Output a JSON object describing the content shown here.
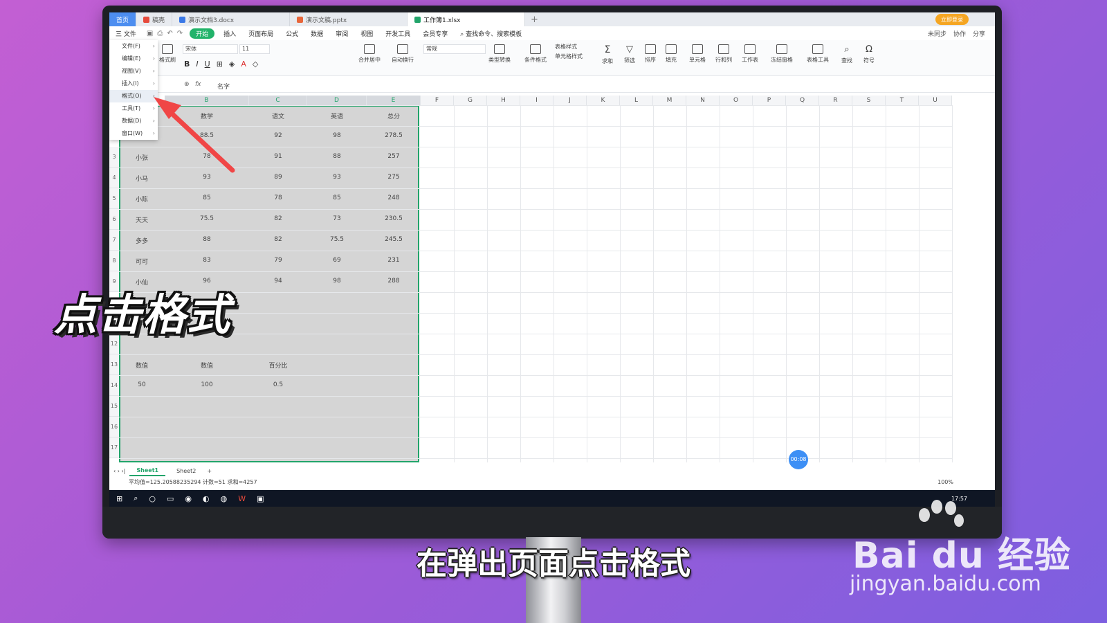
{
  "tabs": [
    {
      "label": "首页",
      "kind": "home"
    },
    {
      "label": "稿壳",
      "kind": "doc",
      "color": "#e64a3b"
    },
    {
      "label": "演示文档3.docx",
      "kind": "doc",
      "color": "#3a78e7"
    },
    {
      "label": "演示文稿.pptx",
      "kind": "doc",
      "color": "#e8663a"
    },
    {
      "label": "工作簿1.xlsx",
      "kind": "active",
      "color": "#22a46a"
    }
  ],
  "login_label": "立即登录",
  "menubar": {
    "file": "三 文件",
    "items": [
      "开始",
      "插入",
      "页面布局",
      "公式",
      "数据",
      "审阅",
      "视图",
      "开发工具",
      "会员专享"
    ],
    "search": "查找命令、搜索模板",
    "sync": "未同步",
    "collab": "协作",
    "share": "分享"
  },
  "ribbon": {
    "format_painter": "格式刷",
    "font_name": "宋体",
    "font_size": "11",
    "number_format": "常规",
    "merge": "合并居中",
    "wrap": "自动换行",
    "type_convert": "类型转换",
    "cond_format": "条件格式",
    "table_style": "表格样式",
    "cell_style": "单元格样式",
    "sum": "求和",
    "filter": "筛选",
    "sort": "排序",
    "fill": "填充",
    "cell": "单元格",
    "rowcol": "行和列",
    "worksheet": "工作表",
    "freeze": "冻结窗格",
    "table_tools": "表格工具",
    "find": "查找",
    "symbol": "符号"
  },
  "formula": {
    "content": "名字"
  },
  "file_menu": [
    {
      "label": "文件(F)"
    },
    {
      "label": "编辑(E)"
    },
    {
      "label": "视图(V)"
    },
    {
      "label": "插入(I)"
    },
    {
      "label": "格式(O)"
    },
    {
      "label": "工具(T)"
    },
    {
      "label": "数据(D)"
    },
    {
      "label": "窗口(W)"
    }
  ],
  "columns": [
    "B",
    "C",
    "D",
    "E",
    "F",
    "G",
    "H",
    "I",
    "J",
    "K",
    "L",
    "M",
    "N",
    "O",
    "P",
    "Q",
    "R",
    "S",
    "T",
    "U"
  ],
  "table": {
    "header": [
      "",
      "数学",
      "语文",
      "英语",
      "总分"
    ],
    "rows": [
      [
        "",
        "88.5",
        "92",
        "98",
        "278.5"
      ],
      [
        "小张",
        "78",
        "91",
        "88",
        "257"
      ],
      [
        "小马",
        "93",
        "89",
        "93",
        "275"
      ],
      [
        "小陈",
        "85",
        "78",
        "85",
        "248"
      ],
      [
        "天天",
        "75.5",
        "82",
        "73",
        "230.5"
      ],
      [
        "多多",
        "88",
        "82",
        "75.5",
        "245.5"
      ],
      [
        "可可",
        "83",
        "79",
        "69",
        "231"
      ],
      [
        "小仙",
        "96",
        "94",
        "98",
        "288"
      ]
    ],
    "extra_header": [
      "数值",
      "数值",
      "百分比"
    ],
    "extra_row": [
      "50",
      "100",
      "0.5"
    ]
  },
  "row_numbers": [
    "3",
    "4",
    "5",
    "6",
    "7",
    "8",
    "9",
    "12",
    "13",
    "14",
    "15",
    "16",
    "17"
  ],
  "sheets": [
    "Sheet1",
    "Sheet2"
  ],
  "status": "平均值=125.20588235294  计数=51  求和=4257",
  "zoom": "100%",
  "timer": "00:08",
  "clock": "17:57",
  "overlay_text": "点击格式",
  "subtitle": "在弹出页面点击格式",
  "watermark": {
    "logo": "Bai du 经验",
    "url": "jingyan.baidu.com"
  },
  "colors": {
    "accent_green": "#22a46a",
    "arrow_red": "#f04646",
    "selection_gray": "#d5d5d5"
  }
}
